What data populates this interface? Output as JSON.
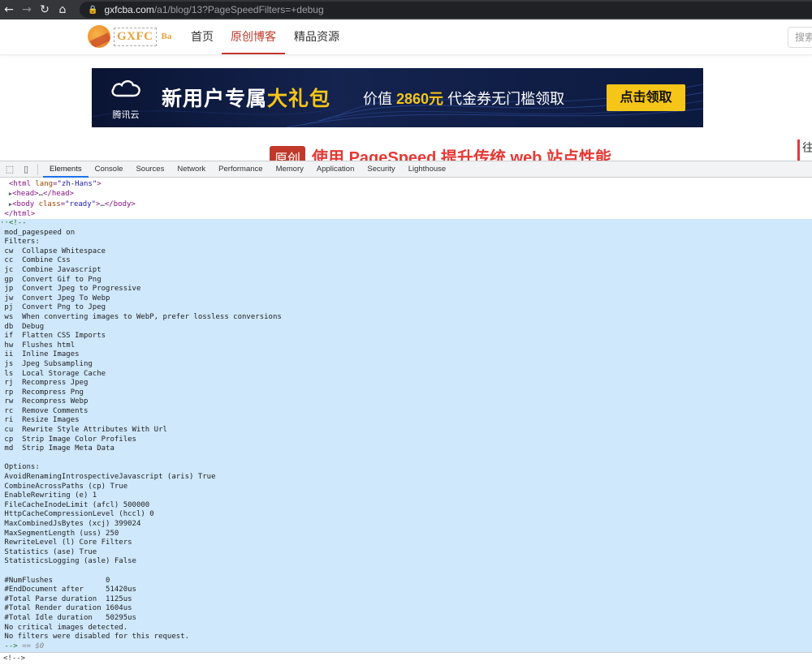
{
  "browser": {
    "url_host": "gxfcba.com",
    "url_path": "/a1/blog/13?PageSpeedFilters=+debug"
  },
  "site": {
    "logo_text": "GXFC",
    "logo_sub": "Ba",
    "nav": [
      {
        "label": "首页"
      },
      {
        "label": "原创博客"
      },
      {
        "label": "精品资源"
      }
    ],
    "search_placeholder": "搜索"
  },
  "banner": {
    "brand": "腾讯云",
    "headline_white": "新用户专属",
    "headline_yellow": "大礼包",
    "value_prefix": "价值",
    "value_amount": "2860元",
    "value_suffix": "代金券无门槛领取",
    "cta": "点击领取"
  },
  "article": {
    "badge": "原创",
    "title": "使用 PageSpeed 提升传统 web 站点性能",
    "side_text": "往"
  },
  "devtools": {
    "tabs": [
      "Elements",
      "Console",
      "Sources",
      "Network",
      "Performance",
      "Memory",
      "Application",
      "Security",
      "Lighthouse"
    ],
    "tree": {
      "html_open_tag": "html",
      "html_lang_attr": "lang",
      "html_lang_val": "\"zh-Hans\"",
      "head": "head",
      "body": "body",
      "body_class_attr": "class",
      "body_class_val": "\"ready\"",
      "html_close": "</html>"
    },
    "comment_open": "<!--",
    "comment_lines": [
      "mod_pagespeed on",
      "Filters:",
      "cw  Collapse Whitespace",
      "cc  Combine Css",
      "jc  Combine Javascript",
      "gp  Convert Gif to Png",
      "jp  Convert Jpeg to Progressive",
      "jw  Convert Jpeg To Webp",
      "pj  Convert Png to Jpeg",
      "ws  When converting images to WebP, prefer lossless conversions",
      "db  Debug",
      "if  Flatten CSS Imports",
      "hw  Flushes html",
      "ii  Inline Images",
      "js  Jpeg Subsampling",
      "ls  Local Storage Cache",
      "rj  Recompress Jpeg",
      "rp  Recompress Png",
      "rw  Recompress Webp",
      "rc  Remove Comments",
      "ri  Resize Images",
      "cu  Rewrite Style Attributes With Url",
      "cp  Strip Image Color Profiles",
      "md  Strip Image Meta Data",
      "",
      "Options:",
      "AvoidRenamingIntrospectiveJavascript (aris) True",
      "CombineAcrossPaths (cp) True",
      "EnableRewriting (e) 1",
      "FileCacheInodeLimit (afcl) 500000",
      "HttpCacheCompressionLevel (hccl) 0",
      "MaxCombinedJsBytes (xcj) 399024",
      "MaxSegmentLength (uss) 250",
      "RewriteLevel (l) Core Filters",
      "Statistics (ase) True",
      "StatisticsLogging (asle) False",
      "",
      "#NumFlushes            0",
      "#EndDocument after     51420us",
      "#Total Parse duration  1125us",
      "#Total Render duration 1604us",
      "#Total Idle duration   50295us",
      "No critical images detected.",
      "No filters were disabled for this request."
    ],
    "comment_close": "-->",
    "comment_selected": "== $0",
    "breadcrumb": "<!-->"
  }
}
